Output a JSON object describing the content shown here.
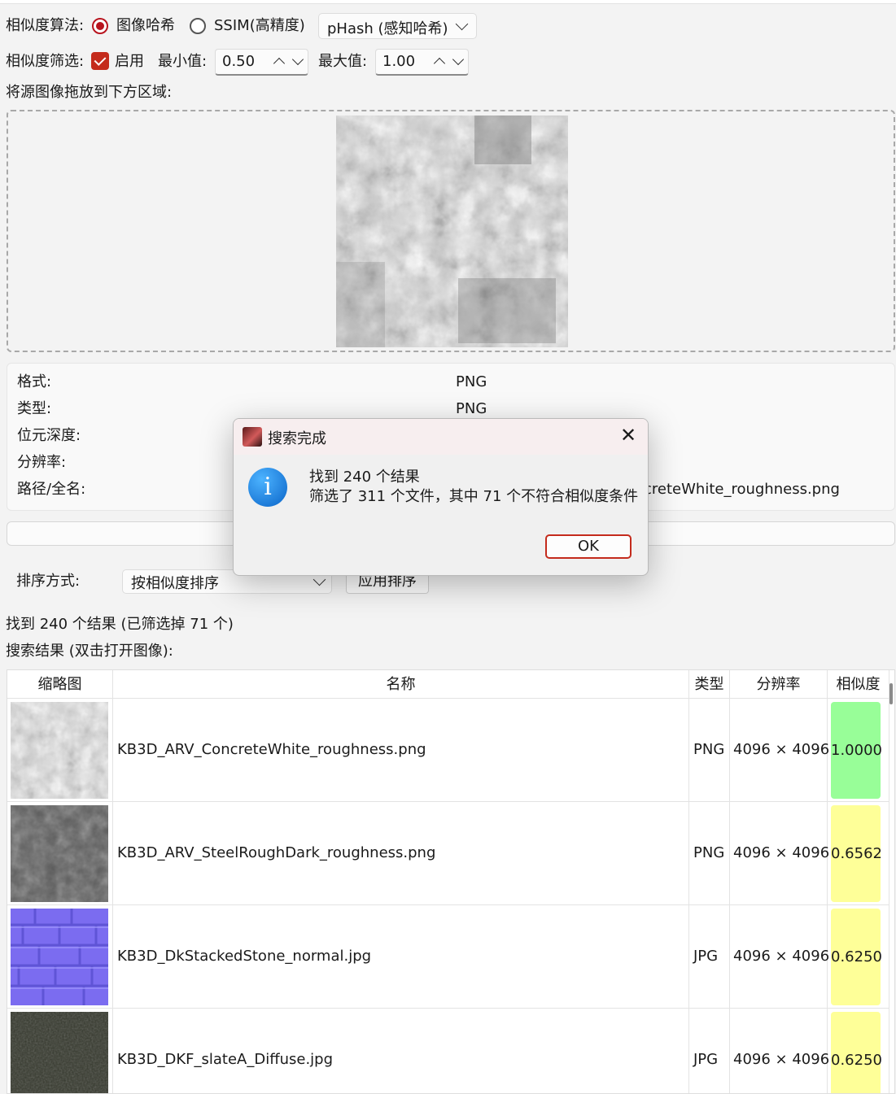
{
  "algorithm": {
    "label": "相似度算法:",
    "option_hash": "图像哈希",
    "option_ssim": "SSIM(高精度)",
    "method_selected": "pHash (感知哈希)"
  },
  "filter": {
    "label": "相似度筛选:",
    "enable_label": "启用",
    "min_label": "最小值:",
    "min_value": "0.50",
    "max_label": "最大值:",
    "max_value": "1.00"
  },
  "drop": {
    "hint": "将源图像拖放到下方区域:"
  },
  "info": {
    "format_label": "格式:",
    "format_value": "PNG",
    "type_label": "类型:",
    "type_value": "PNG",
    "depth_label": "位元深度:",
    "resolution_label": "分辨率:",
    "path_label": "路径/全名:",
    "path_value_visible": "creteWhite_roughness.png"
  },
  "sort": {
    "label": "排序方式:",
    "selected": "按相似度排序",
    "apply_button": "应用排序"
  },
  "summary": "找到 240 个结果 (已筛选掉 71 个)",
  "results_hint": "搜索结果 (双击打开图像):",
  "table": {
    "headers": {
      "thumb": "缩略图",
      "name": "名称",
      "type": "类型",
      "resolution": "分辨率",
      "similarity": "相似度"
    },
    "rows": [
      {
        "name": "KB3D_ARV_ConcreteWhite_roughness.png",
        "type": "PNG",
        "resolution": "4096 × 4096",
        "similarity": "1.0000",
        "color": "#98fe98"
      },
      {
        "name": "KB3D_ARV_SteelRoughDark_roughness.png",
        "type": "PNG",
        "resolution": "4096 × 4096",
        "similarity": "0.6562",
        "color": "#feff98"
      },
      {
        "name": "KB3D_DkStackedStone_normal.jpg",
        "type": "JPG",
        "resolution": "4096 × 4096",
        "similarity": "0.6250",
        "color": "#feff98"
      },
      {
        "name": "KB3D_DKF_slateA_Diffuse.jpg",
        "type": "JPG",
        "resolution": "4096 × 4096",
        "similarity": "0.6250",
        "color": "#feff98"
      }
    ]
  },
  "dialog": {
    "title": "搜索完成",
    "line1": "找到 240 个结果",
    "line2": "筛选了 311 个文件，其中 71 个不符合相似度条件",
    "ok": "OK"
  }
}
